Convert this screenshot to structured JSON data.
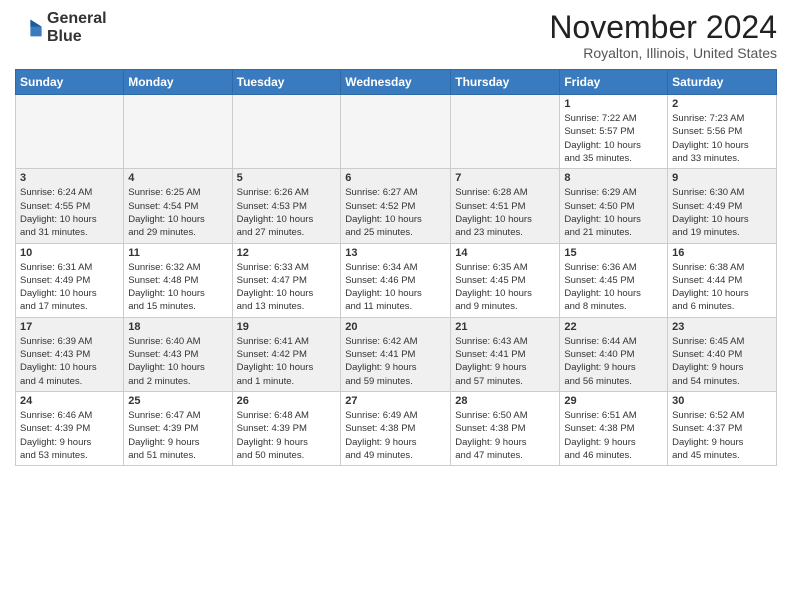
{
  "logo": {
    "line1": "General",
    "line2": "Blue"
  },
  "title": "November 2024",
  "location": "Royalton, Illinois, United States",
  "weekdays": [
    "Sunday",
    "Monday",
    "Tuesday",
    "Wednesday",
    "Thursday",
    "Friday",
    "Saturday"
  ],
  "weeks": [
    [
      {
        "day": "",
        "content": ""
      },
      {
        "day": "",
        "content": ""
      },
      {
        "day": "",
        "content": ""
      },
      {
        "day": "",
        "content": ""
      },
      {
        "day": "",
        "content": ""
      },
      {
        "day": "1",
        "content": "Sunrise: 7:22 AM\nSunset: 5:57 PM\nDaylight: 10 hours\nand 35 minutes."
      },
      {
        "day": "2",
        "content": "Sunrise: 7:23 AM\nSunset: 5:56 PM\nDaylight: 10 hours\nand 33 minutes."
      }
    ],
    [
      {
        "day": "3",
        "content": "Sunrise: 6:24 AM\nSunset: 4:55 PM\nDaylight: 10 hours\nand 31 minutes."
      },
      {
        "day": "4",
        "content": "Sunrise: 6:25 AM\nSunset: 4:54 PM\nDaylight: 10 hours\nand 29 minutes."
      },
      {
        "day": "5",
        "content": "Sunrise: 6:26 AM\nSunset: 4:53 PM\nDaylight: 10 hours\nand 27 minutes."
      },
      {
        "day": "6",
        "content": "Sunrise: 6:27 AM\nSunset: 4:52 PM\nDaylight: 10 hours\nand 25 minutes."
      },
      {
        "day": "7",
        "content": "Sunrise: 6:28 AM\nSunset: 4:51 PM\nDaylight: 10 hours\nand 23 minutes."
      },
      {
        "day": "8",
        "content": "Sunrise: 6:29 AM\nSunset: 4:50 PM\nDaylight: 10 hours\nand 21 minutes."
      },
      {
        "day": "9",
        "content": "Sunrise: 6:30 AM\nSunset: 4:49 PM\nDaylight: 10 hours\nand 19 minutes."
      }
    ],
    [
      {
        "day": "10",
        "content": "Sunrise: 6:31 AM\nSunset: 4:49 PM\nDaylight: 10 hours\nand 17 minutes."
      },
      {
        "day": "11",
        "content": "Sunrise: 6:32 AM\nSunset: 4:48 PM\nDaylight: 10 hours\nand 15 minutes."
      },
      {
        "day": "12",
        "content": "Sunrise: 6:33 AM\nSunset: 4:47 PM\nDaylight: 10 hours\nand 13 minutes."
      },
      {
        "day": "13",
        "content": "Sunrise: 6:34 AM\nSunset: 4:46 PM\nDaylight: 10 hours\nand 11 minutes."
      },
      {
        "day": "14",
        "content": "Sunrise: 6:35 AM\nSunset: 4:45 PM\nDaylight: 10 hours\nand 9 minutes."
      },
      {
        "day": "15",
        "content": "Sunrise: 6:36 AM\nSunset: 4:45 PM\nDaylight: 10 hours\nand 8 minutes."
      },
      {
        "day": "16",
        "content": "Sunrise: 6:38 AM\nSunset: 4:44 PM\nDaylight: 10 hours\nand 6 minutes."
      }
    ],
    [
      {
        "day": "17",
        "content": "Sunrise: 6:39 AM\nSunset: 4:43 PM\nDaylight: 10 hours\nand 4 minutes."
      },
      {
        "day": "18",
        "content": "Sunrise: 6:40 AM\nSunset: 4:43 PM\nDaylight: 10 hours\nand 2 minutes."
      },
      {
        "day": "19",
        "content": "Sunrise: 6:41 AM\nSunset: 4:42 PM\nDaylight: 10 hours\nand 1 minute."
      },
      {
        "day": "20",
        "content": "Sunrise: 6:42 AM\nSunset: 4:41 PM\nDaylight: 9 hours\nand 59 minutes."
      },
      {
        "day": "21",
        "content": "Sunrise: 6:43 AM\nSunset: 4:41 PM\nDaylight: 9 hours\nand 57 minutes."
      },
      {
        "day": "22",
        "content": "Sunrise: 6:44 AM\nSunset: 4:40 PM\nDaylight: 9 hours\nand 56 minutes."
      },
      {
        "day": "23",
        "content": "Sunrise: 6:45 AM\nSunset: 4:40 PM\nDaylight: 9 hours\nand 54 minutes."
      }
    ],
    [
      {
        "day": "24",
        "content": "Sunrise: 6:46 AM\nSunset: 4:39 PM\nDaylight: 9 hours\nand 53 minutes."
      },
      {
        "day": "25",
        "content": "Sunrise: 6:47 AM\nSunset: 4:39 PM\nDaylight: 9 hours\nand 51 minutes."
      },
      {
        "day": "26",
        "content": "Sunrise: 6:48 AM\nSunset: 4:39 PM\nDaylight: 9 hours\nand 50 minutes."
      },
      {
        "day": "27",
        "content": "Sunrise: 6:49 AM\nSunset: 4:38 PM\nDaylight: 9 hours\nand 49 minutes."
      },
      {
        "day": "28",
        "content": "Sunrise: 6:50 AM\nSunset: 4:38 PM\nDaylight: 9 hours\nand 47 minutes."
      },
      {
        "day": "29",
        "content": "Sunrise: 6:51 AM\nSunset: 4:38 PM\nDaylight: 9 hours\nand 46 minutes."
      },
      {
        "day": "30",
        "content": "Sunrise: 6:52 AM\nSunset: 4:37 PM\nDaylight: 9 hours\nand 45 minutes."
      }
    ]
  ]
}
